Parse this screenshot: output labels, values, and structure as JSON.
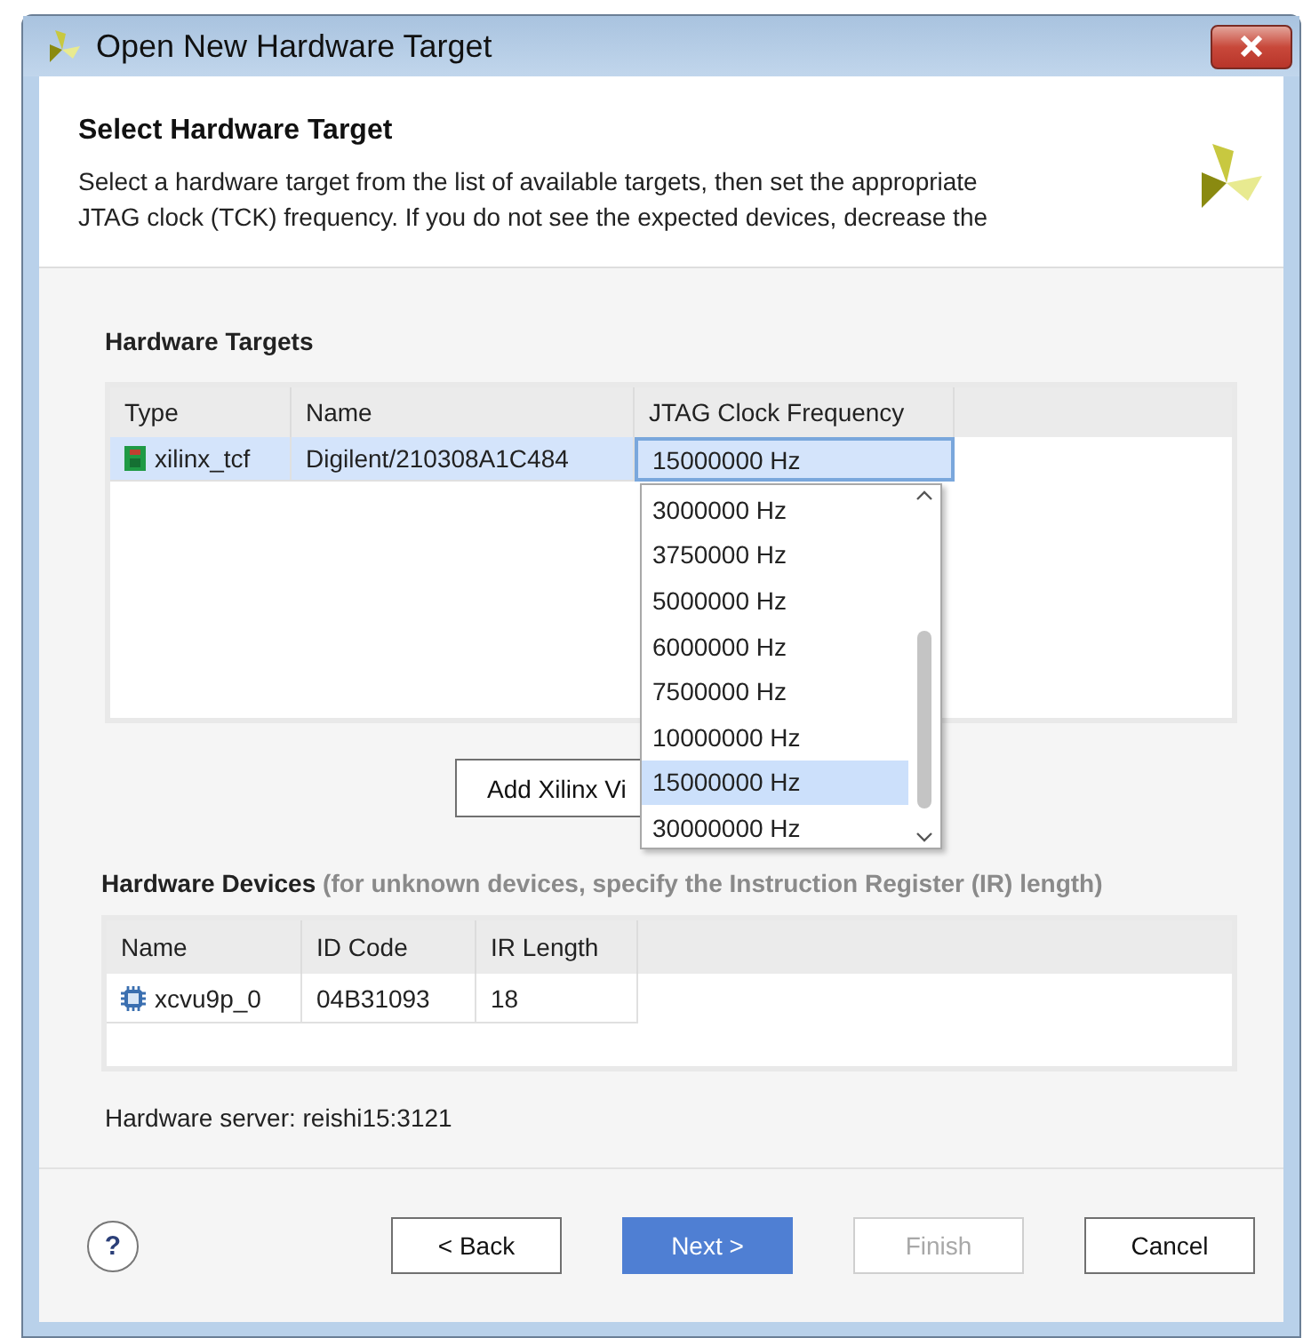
{
  "window": {
    "title": "Open New Hardware Target"
  },
  "header": {
    "title": "Select Hardware Target",
    "description_lines": [
      "Select a hardware target from the list of available targets, then set the appropriate",
      "JTAG clock (TCK) frequency. If you do not see the expected devices, decrease the"
    ]
  },
  "hardware_targets": {
    "label": "Hardware Targets",
    "columns": [
      "Type",
      "Name",
      "JTAG Clock Frequency"
    ],
    "rows": [
      {
        "selected": true,
        "cells": [
          "xilinx_tcf",
          "Digilent/210308A1C484",
          "15000000 Hz"
        ]
      }
    ]
  },
  "frequency_dropdown": {
    "expanded": true,
    "options": [
      {
        "label": "3000000 Hz",
        "selected": false
      },
      {
        "label": "3750000 Hz",
        "selected": false
      },
      {
        "label": "5000000 Hz",
        "selected": false
      },
      {
        "label": "6000000 Hz",
        "selected": false
      },
      {
        "label": "7500000 Hz",
        "selected": false
      },
      {
        "label": "10000000 Hz",
        "selected": false
      },
      {
        "label": "15000000 Hz",
        "selected": true
      },
      {
        "label": "30000000 Hz",
        "selected": false
      }
    ]
  },
  "add_button": {
    "label": "Add Xilinx Vi"
  },
  "hardware_devices": {
    "label": "Hardware Devices",
    "hint": "(for unknown devices, specify the Instruction Register (IR) length)",
    "columns": [
      "Name",
      "ID Code",
      "IR Length"
    ],
    "rows": [
      {
        "cells": [
          "xcvu9p_0",
          "04B31093",
          "18"
        ]
      }
    ]
  },
  "server": "Hardware server: reishi15:3121",
  "help": "?",
  "buttons": [
    {
      "label": "< Back",
      "kind": "normal",
      "disabled": false
    },
    {
      "label": "Next >",
      "kind": "default",
      "disabled": false
    },
    {
      "label": "Finish",
      "kind": "normal",
      "disabled": true
    },
    {
      "label": "Cancel",
      "kind": "normal",
      "disabled": false
    }
  ]
}
